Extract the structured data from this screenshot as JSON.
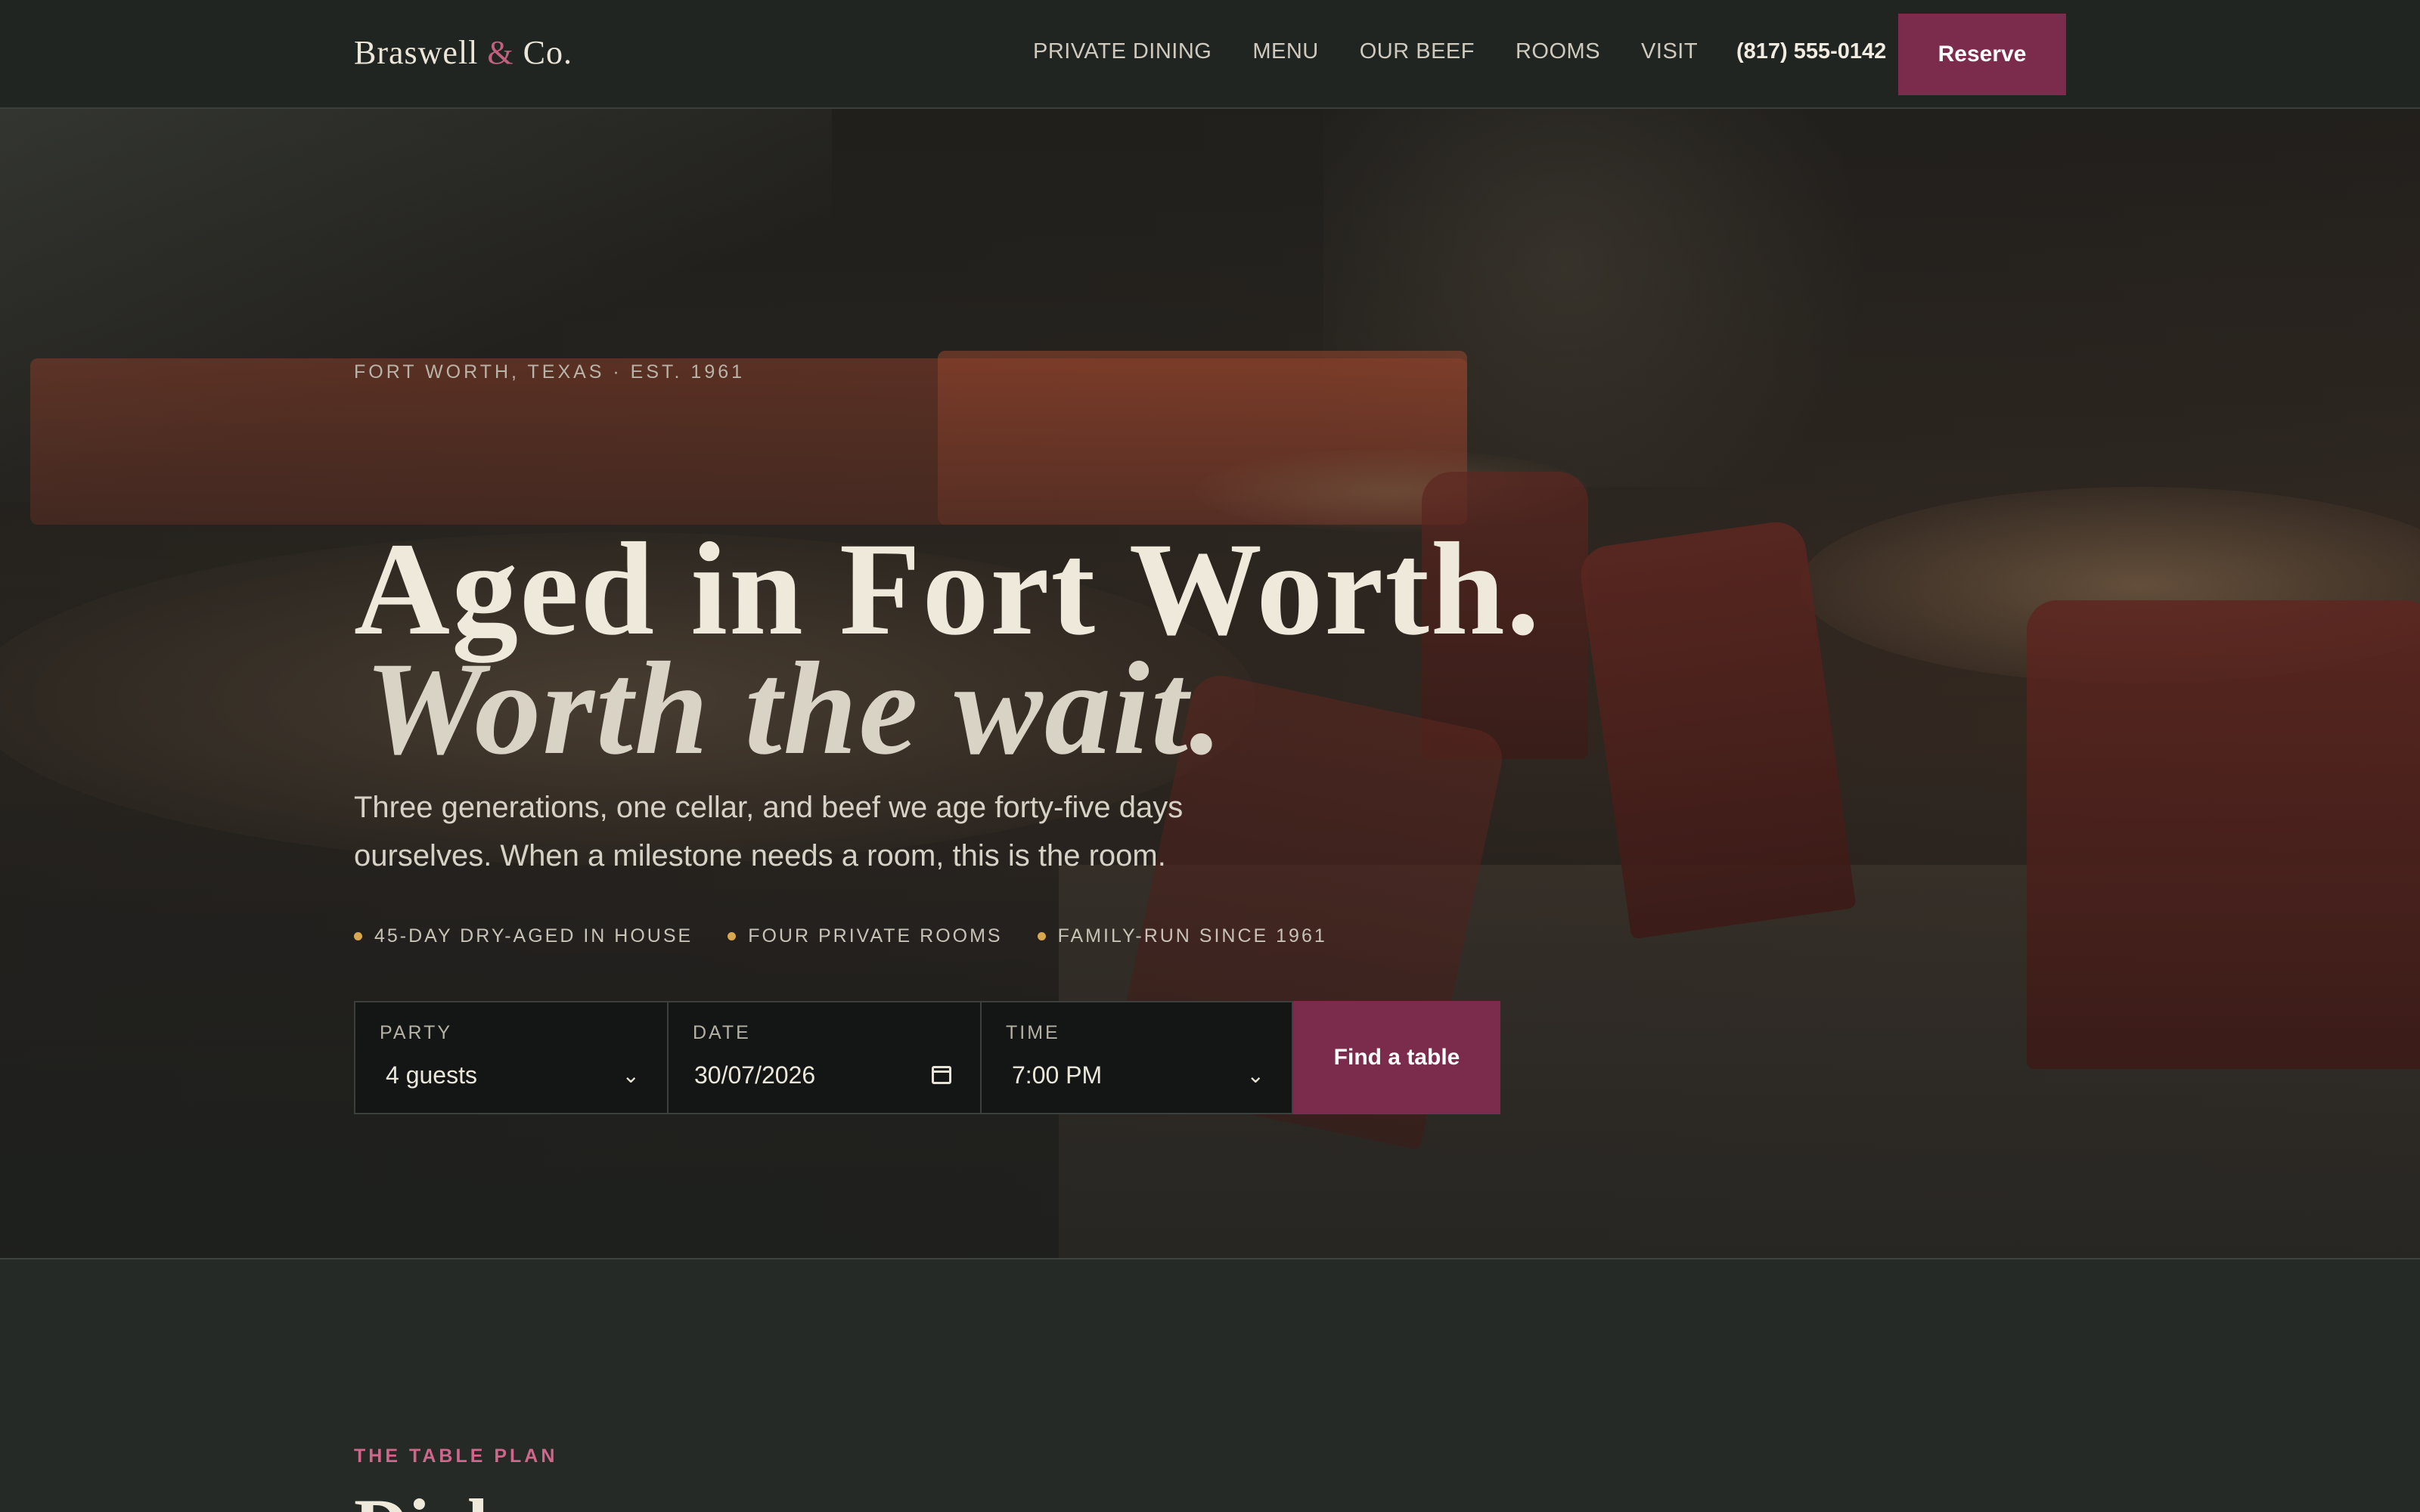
{
  "nav": {
    "brand_first": "Braswell",
    "brand_amp": "&",
    "brand_last": "Co.",
    "links": [
      "PRIVATE DINING",
      "MENU",
      "OUR BEEF",
      "ROOMS",
      "VISIT"
    ],
    "phone": "(817) 555-0142",
    "reserve_label": "Reserve"
  },
  "hero": {
    "eyebrow": "FORT WORTH, TEXAS  ·  EST. 1961",
    "headline_line1": "Aged in Fort Worth.",
    "headline_line2": "Worth the wait.",
    "lede": "Three generations, one cellar, and beef we age forty-five days ourselves. When a milestone needs a room, this is the room.",
    "features": [
      "45-DAY DRY-AGED IN HOUSE",
      "FOUR PRIVATE ROOMS",
      "FAMILY-RUN SINCE 1961"
    ]
  },
  "booking": {
    "party_label": "PARTY",
    "party_value": "4 guests",
    "date_label": "DATE",
    "date_value": "30/07/2026",
    "time_label": "TIME",
    "time_value": "7:00 PM",
    "submit_label": "Find a table"
  },
  "section": {
    "kicker": "THE TABLE PLAN",
    "title_partial": "Dial"
  },
  "colors": {
    "accent": "#7b2b4b",
    "kicker_pink": "#d0668c",
    "feature_dot": "#d9a74f",
    "nav_bg": "#202522",
    "page_bg": "#252a27"
  }
}
